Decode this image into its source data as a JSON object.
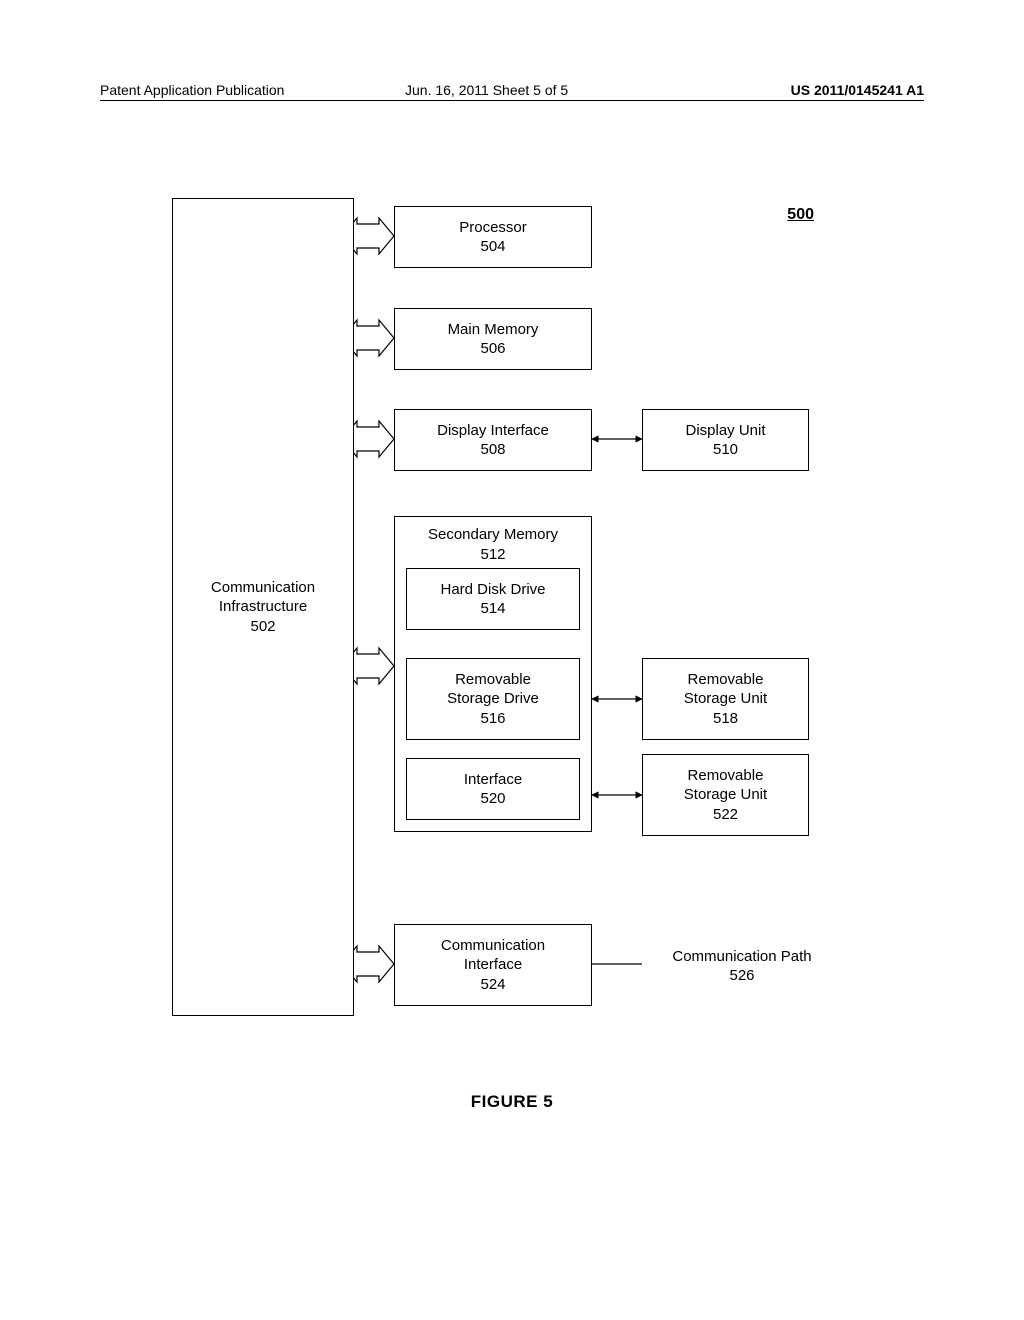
{
  "header": {
    "left": "Patent Application Publication",
    "center": "Jun. 16, 2011  Sheet 5 of 5",
    "right": "US 2011/0145241 A1"
  },
  "figure_tag": "500",
  "caption": "FIGURE 5",
  "blocks": {
    "comm_infra": {
      "label": "Communication\nInfrastructure",
      "num": "502"
    },
    "processor": {
      "label": "Processor",
      "num": "504"
    },
    "main_mem": {
      "label": "Main Memory",
      "num": "506"
    },
    "disp_if": {
      "label": "Display Interface",
      "num": "508"
    },
    "disp_unit": {
      "label": "Display Unit",
      "num": "510"
    },
    "sec_mem": {
      "label": "Secondary Memory",
      "num": "512"
    },
    "hdd": {
      "label": "Hard Disk Drive",
      "num": "514"
    },
    "rem_drive": {
      "label": "Removable\nStorage Drive",
      "num": "516"
    },
    "rem_unit1": {
      "label": "Removable\nStorage Unit",
      "num": "518"
    },
    "iface": {
      "label": "Interface",
      "num": "520"
    },
    "rem_unit2": {
      "label": "Removable\nStorage Unit",
      "num": "522"
    },
    "comm_if": {
      "label": "Communication\nInterface",
      "num": "524"
    },
    "comm_path": {
      "label": "Communication Path",
      "num": "526"
    }
  }
}
